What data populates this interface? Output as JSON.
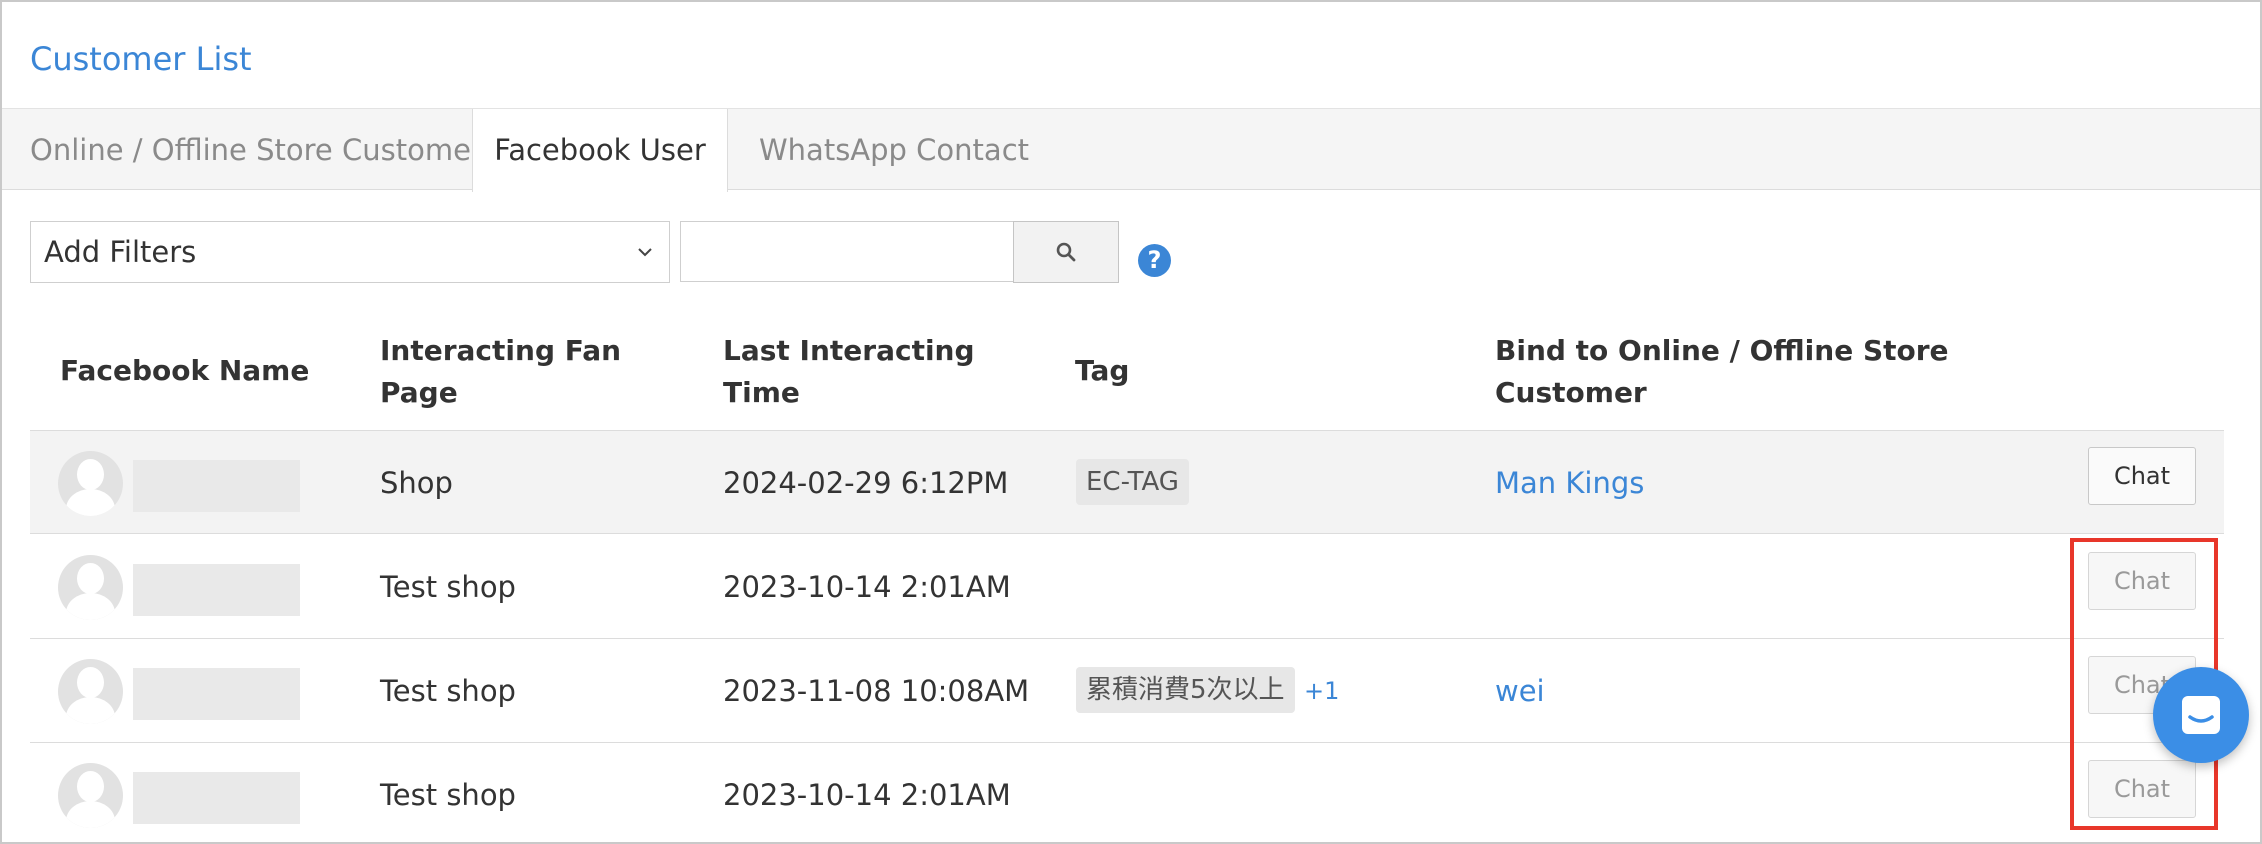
{
  "page_title": "Customer List",
  "tabs": [
    {
      "label": "Online / Offline Store Customer",
      "active": false
    },
    {
      "label": "Facebook User",
      "active": true
    },
    {
      "label": "WhatsApp Contact",
      "active": false
    }
  ],
  "filters": {
    "select_value": "Add Filters",
    "search_value": "",
    "search_icon": "search-icon",
    "help_icon": "help-icon",
    "help_glyph": "?"
  },
  "table": {
    "headers": {
      "facebook_name": "Facebook Name",
      "fan_page_line1": "Interacting Fan",
      "fan_page_line2": "Page",
      "time_line1": "Last Interacting",
      "time_line2": "Time",
      "tag": "Tag",
      "bind_line1": "Bind to Online / Offline Store",
      "bind_line2": "Customer"
    },
    "rows": [
      {
        "fan_page": "Shop",
        "last_time": "2024-02-29 6:12PM",
        "tag": "EC-TAG",
        "tag_more": "",
        "bind": "Man Kings",
        "action": "Chat"
      },
      {
        "fan_page": "Test shop",
        "last_time": "2023-10-14 2:01AM",
        "tag": "",
        "tag_more": "",
        "bind": "",
        "action": "Chat"
      },
      {
        "fan_page": "Test shop",
        "last_time": "2023-11-08 10:08AM",
        "tag": "累積消費5次以上",
        "tag_more": "+1",
        "bind": "wei",
        "action": "Chat"
      },
      {
        "fan_page": "Test shop",
        "last_time": "2023-10-14 2:01AM",
        "tag": "",
        "tag_more": "",
        "bind": "",
        "action": "Chat"
      }
    ]
  },
  "colors": {
    "accent": "#3b86d6",
    "highlight": "#e8362a",
    "fab": "#3b8ee6"
  },
  "messenger_icon": "messenger-chat-icon"
}
